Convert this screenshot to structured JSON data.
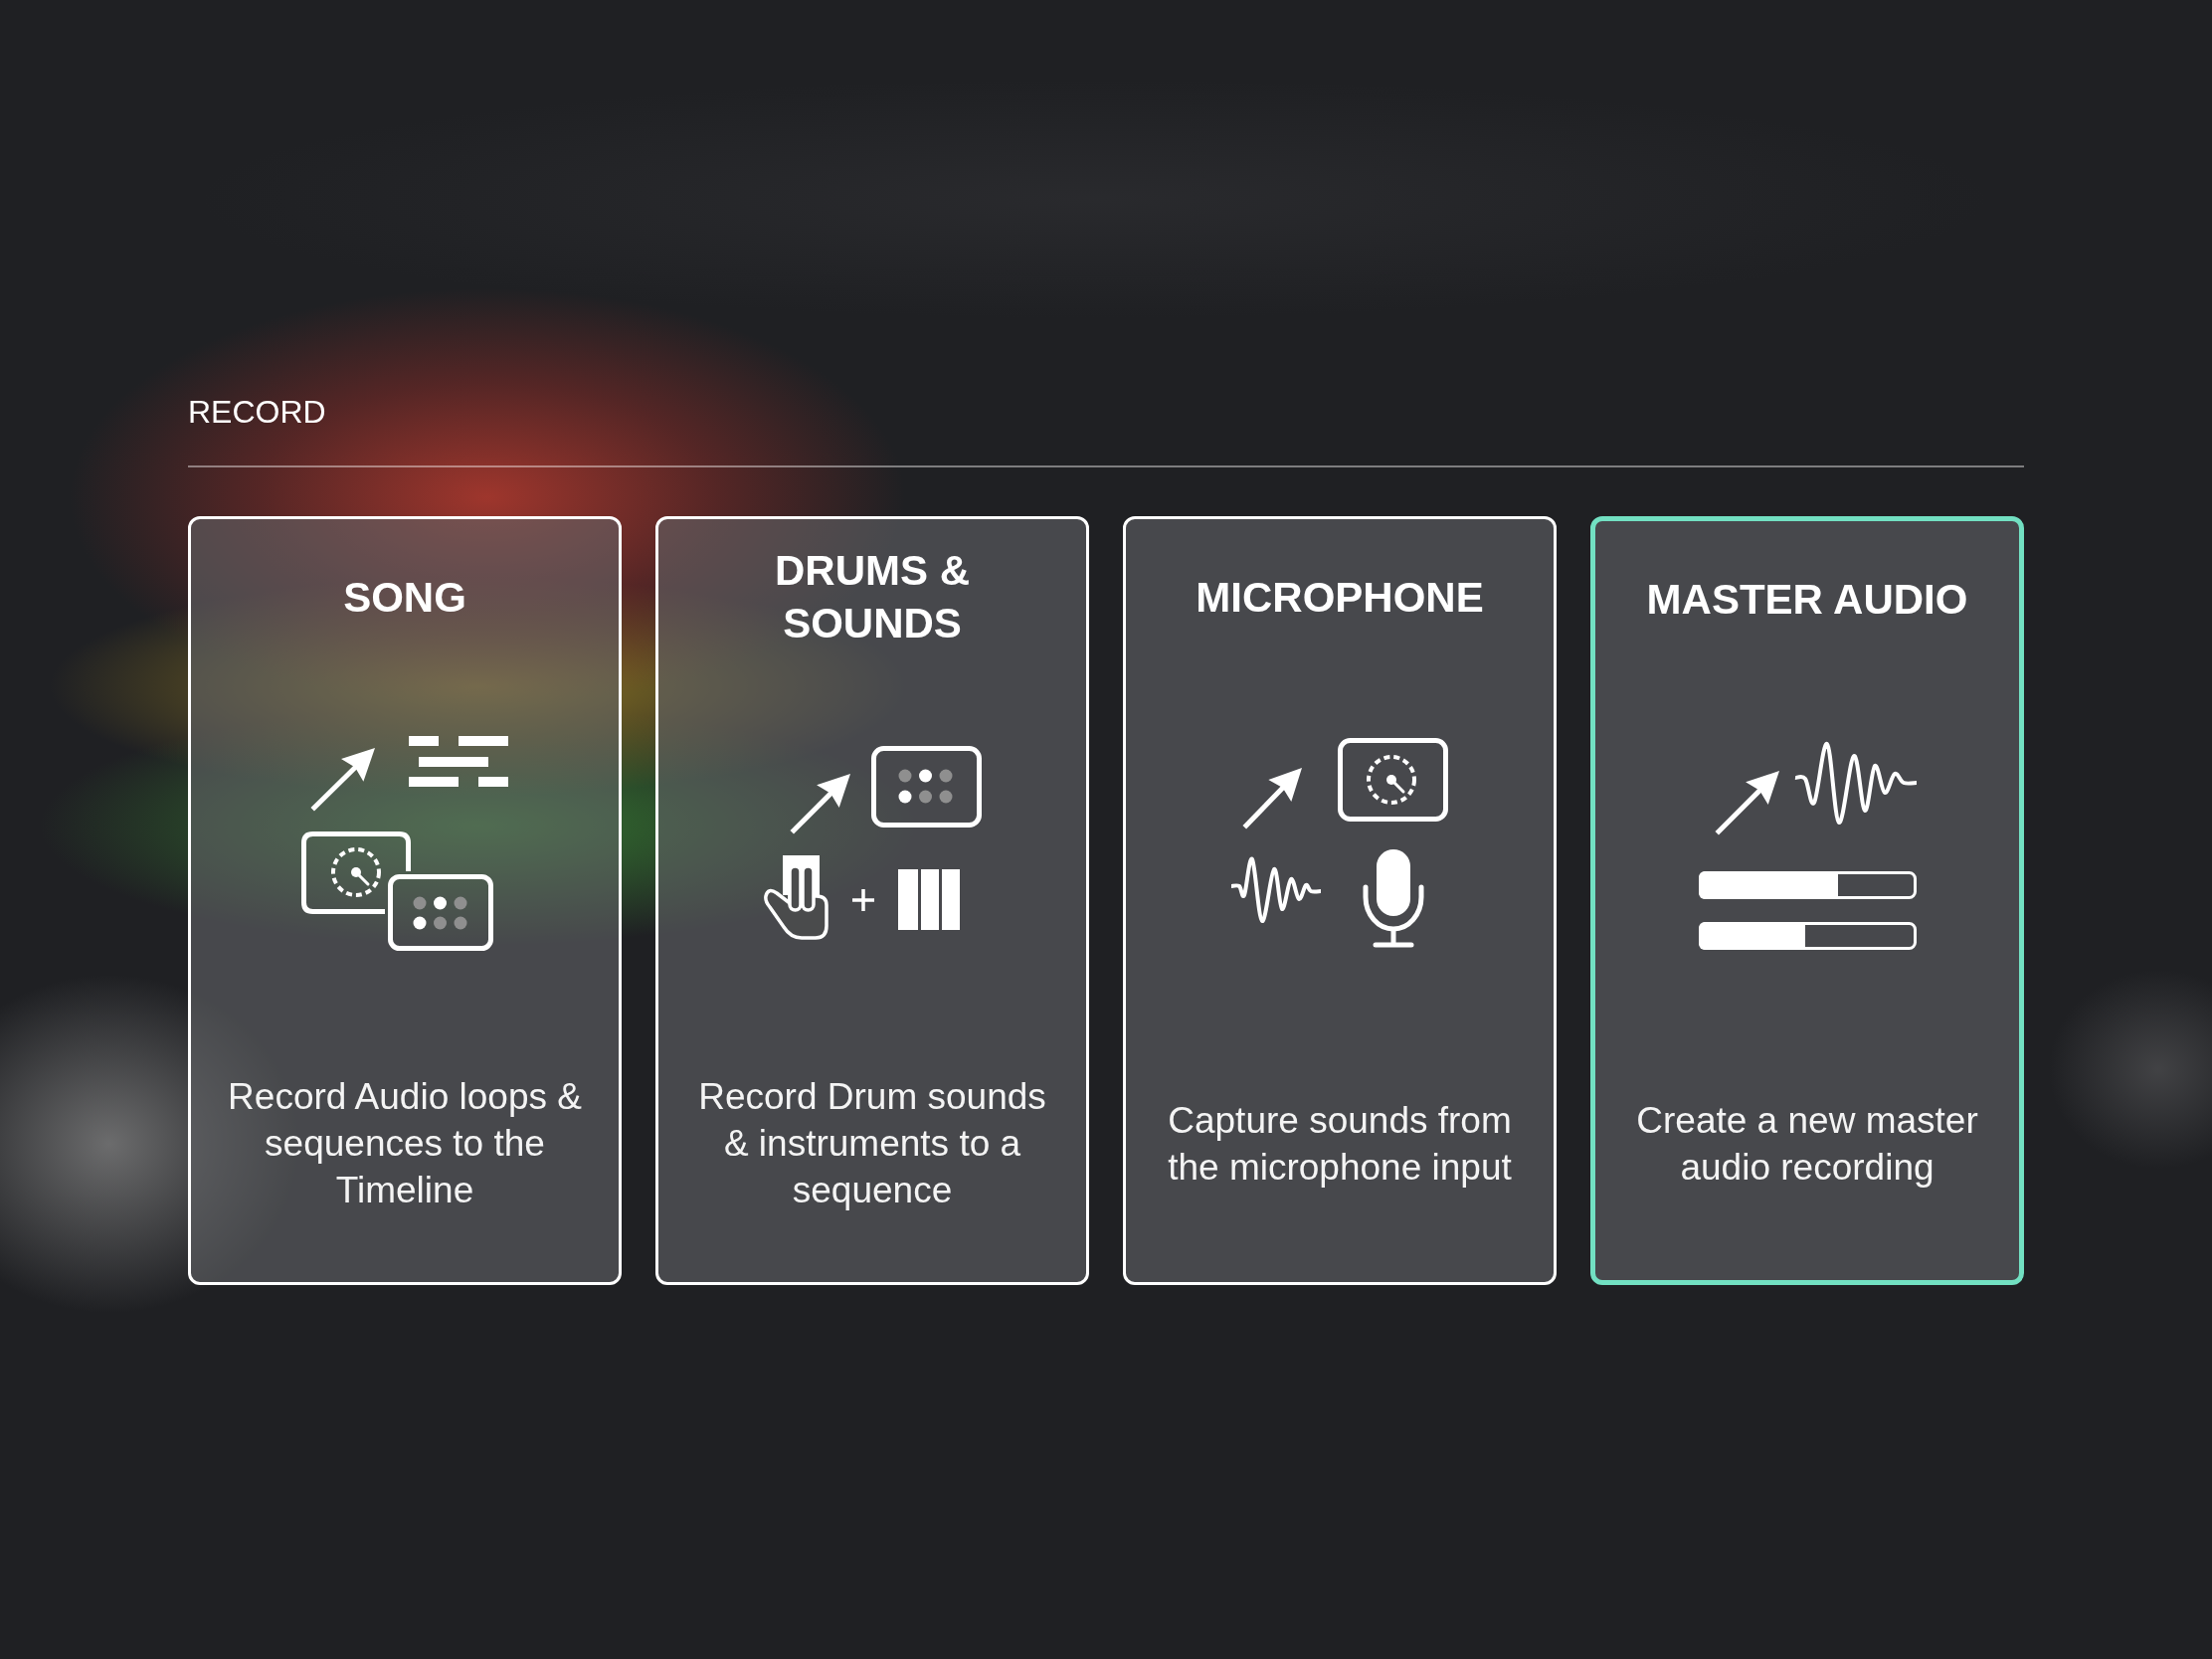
{
  "section": {
    "title": "RECORD"
  },
  "cards": [
    {
      "kind": "song",
      "title": "SONG",
      "description": "Record Audio loops & sequences to the Timeline",
      "selected": false
    },
    {
      "kind": "drums",
      "title": "DRUMS & SOUNDS",
      "description": "Record Drum sounds & instruments to a sequence",
      "selected": false
    },
    {
      "kind": "microphone",
      "title": "MICROPHONE",
      "description": "Capture sounds from the microphone input",
      "selected": false
    },
    {
      "kind": "master",
      "title": "MASTER AUDIO",
      "description": "Create a new master audio recording",
      "selected": true
    }
  ]
}
